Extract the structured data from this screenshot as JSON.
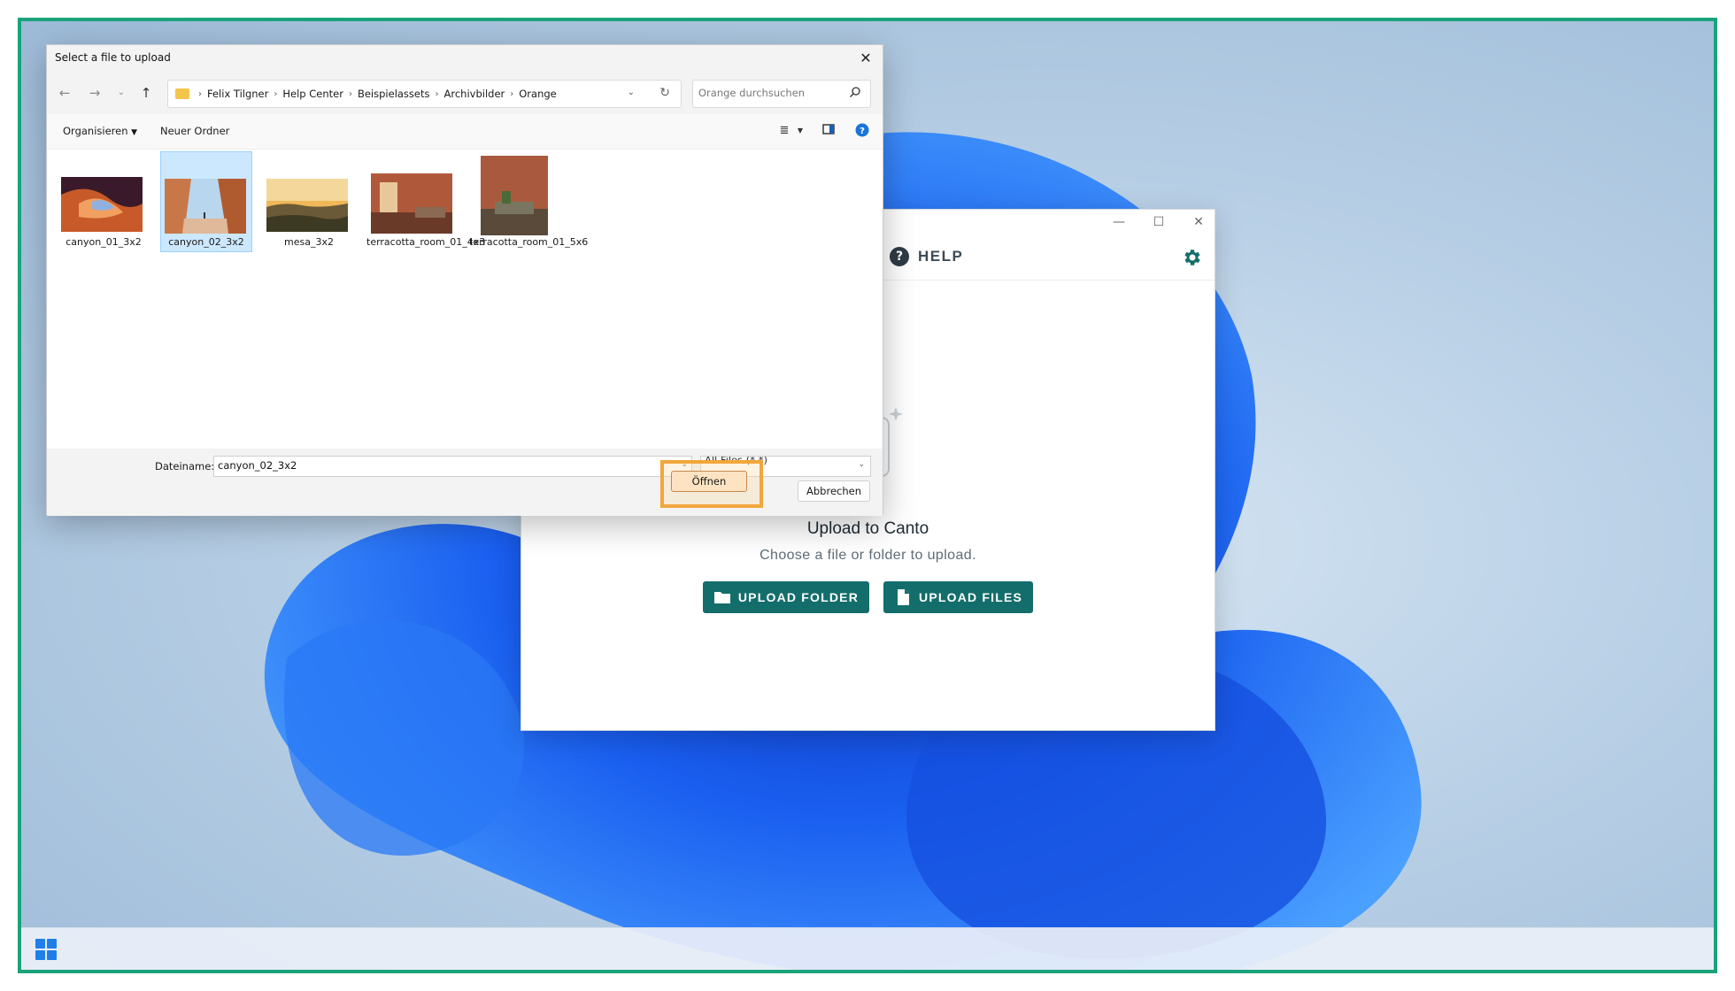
{
  "dialog": {
    "title": "Select a file to upload",
    "breadcrumbs": [
      "Felix Tilgner",
      "Help Center",
      "Beispielassets",
      "Archivbilder",
      "Orange"
    ],
    "search_placeholder": "Orange durchsuchen",
    "organize_label": "Organisieren",
    "new_folder_label": "Neuer Ordner",
    "files": [
      {
        "name": "canyon_01_3x2",
        "selected": false
      },
      {
        "name": "canyon_02_3x2",
        "selected": true
      },
      {
        "name": "mesa_3x2",
        "selected": false
      },
      {
        "name": "terracotta_room_01_4x3",
        "selected": false
      },
      {
        "name": "terracotta_room_01_5x6",
        "selected": false
      }
    ],
    "filename_label": "Dateiname:",
    "filename_value": "canyon_02_3x2",
    "filetype_value": "All Files (*.*)",
    "open_label": "Öffnen",
    "cancel_label": "Abbrechen"
  },
  "canto": {
    "help_label": "HELP",
    "upload_title": "Upload to Canto",
    "upload_subtitle": "Choose a file or folder to upload.",
    "upload_folder_label": "UPLOAD FOLDER",
    "upload_files_label": "UPLOAD FILES",
    "accent_color": "#136e6b"
  }
}
